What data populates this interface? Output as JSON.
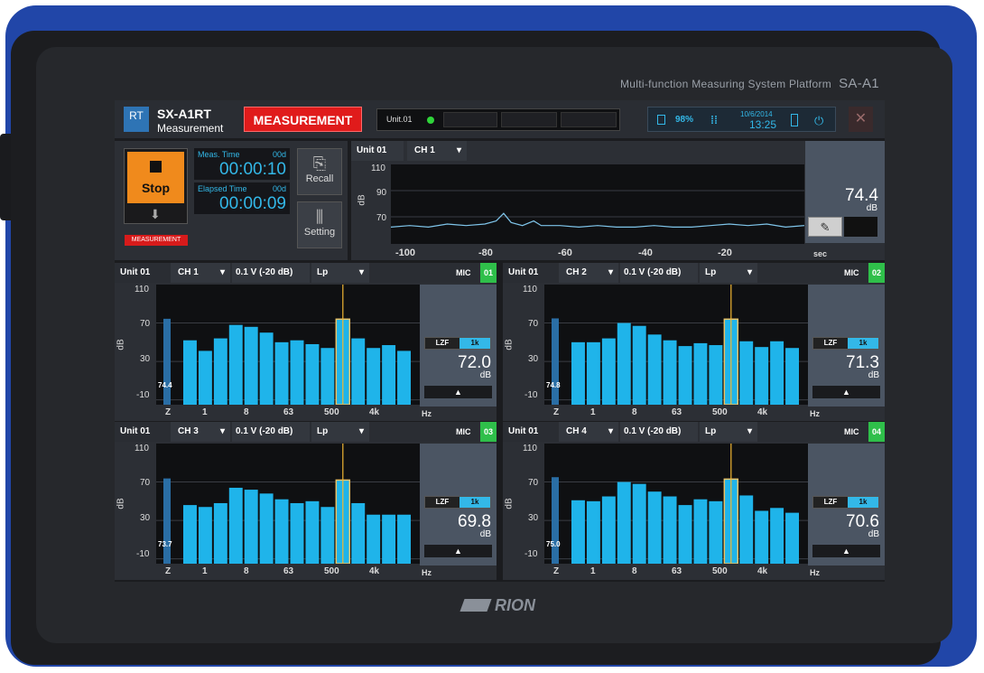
{
  "device": {
    "platform_label": "Multi-function Measuring System  Platform",
    "model": "SA-A1",
    "maker": "RION"
  },
  "header": {
    "logo_text": "RT",
    "app_name": "SX-A1RT",
    "app_mode": "Measurement",
    "state_button": "MEASUREMENT",
    "unit_label": "Unit.01",
    "battery_pct": "98%",
    "date": "10/6/2014",
    "time": "13:25",
    "close_glyph": "✕",
    "colors": {
      "accent": "#33b8e8",
      "state": "#e01b1b",
      "ok": "#2fd43a"
    }
  },
  "control": {
    "stop_label": "Stop",
    "state_badge": "MEASUREMENT",
    "meas_time_label": "Meas. Time",
    "meas_days": "00d",
    "meas_time": "00:00:10",
    "elapsed_label": "Elapsed Time",
    "elapsed_days": "00d",
    "elapsed_time": "00:00:09",
    "recall_label": "Recall",
    "setting_label": "Setting"
  },
  "timeseries": {
    "unit": "Unit 01",
    "channel": "CH 1",
    "ylabel": "dB",
    "yticks": [
      "110",
      "90",
      "70"
    ],
    "xticks": [
      "-100",
      "-80",
      "-60",
      "-40",
      "-20",
      "sec"
    ],
    "value": "74.4",
    "value_unit": "dB"
  },
  "chart_data": [
    {
      "type": "line",
      "xlabel": "sec",
      "ylabel": "dB",
      "xlim": [
        -110,
        0
      ],
      "ylim": [
        60,
        112
      ],
      "x": [
        -110,
        -105,
        -100,
        -95,
        -90,
        -85,
        -82,
        -80,
        -78,
        -75,
        -72,
        -70,
        -65,
        -60,
        -55,
        -50,
        -45,
        -40,
        -35,
        -30,
        -25,
        -20,
        -15,
        -10,
        -5,
        0
      ],
      "y": [
        71,
        72,
        71,
        73,
        72,
        73,
        75,
        80,
        74,
        72,
        75,
        72,
        72,
        71,
        72,
        71,
        71,
        72,
        71,
        71,
        72,
        73,
        72,
        73,
        71,
        72
      ]
    },
    {
      "type": "bar",
      "title": "",
      "ylabel": "dB",
      "ylim": [
        -15,
        110
      ],
      "categories": [
        "Z",
        "1",
        "",
        "",
        "8",
        "",
        "",
        "63",
        "",
        "",
        "500",
        "",
        "",
        "4k",
        "",
        ""
      ],
      "values": [
        74.4,
        52,
        41,
        54,
        68,
        66,
        60,
        50,
        52,
        48,
        44,
        74,
        54,
        44,
        47,
        41
      ],
      "highlight_index": 11
    },
    {
      "type": "bar",
      "title": "",
      "ylabel": "dB",
      "ylim": [
        -15,
        110
      ],
      "categories": [
        "Z",
        "1",
        "",
        "",
        "8",
        "",
        "",
        "63",
        "",
        "",
        "500",
        "",
        "",
        "4k",
        "",
        ""
      ],
      "values": [
        74.8,
        50,
        50,
        54,
        70,
        67,
        58,
        52,
        46,
        49,
        47,
        74,
        51,
        45,
        51,
        44
      ],
      "highlight_index": 11
    },
    {
      "type": "bar",
      "title": "",
      "ylabel": "dB",
      "ylim": [
        -15,
        110
      ],
      "categories": [
        "Z",
        "1",
        "",
        "",
        "8",
        "",
        "",
        "63",
        "",
        "",
        "500",
        "",
        "",
        "4k",
        "",
        ""
      ],
      "values": [
        73.7,
        46,
        44,
        48,
        64,
        62,
        58,
        52,
        48,
        50,
        44,
        72,
        48,
        36,
        36,
        36
      ],
      "highlight_index": 11
    },
    {
      "type": "bar",
      "title": "",
      "ylabel": "dB",
      "ylim": [
        -15,
        110
      ],
      "categories": [
        "Z",
        "1",
        "",
        "",
        "8",
        "",
        "",
        "63",
        "",
        "",
        "500",
        "",
        "",
        "4k",
        "",
        ""
      ],
      "values": [
        75.0,
        51,
        50,
        55,
        70,
        68,
        60,
        55,
        46,
        52,
        50,
        73,
        56,
        40,
        43,
        38
      ],
      "highlight_index": 11
    }
  ],
  "spectrum": {
    "panels": [
      {
        "unit": "Unit 01",
        "channel": "CH 1",
        "range": "0.1 V (-20 dB)",
        "metric": "Lp",
        "mic": "MIC",
        "mic_no": "01",
        "value": "72.0",
        "zlabel": "74.4"
      },
      {
        "unit": "Unit 01",
        "channel": "CH 2",
        "range": "0.1 V (-20 dB)",
        "metric": "Lp",
        "mic": "MIC",
        "mic_no": "02",
        "value": "71.3",
        "zlabel": "74.8"
      },
      {
        "unit": "Unit 01",
        "channel": "CH 3",
        "range": "0.1 V (-20 dB)",
        "metric": "Lp",
        "mic": "MIC",
        "mic_no": "03",
        "value": "69.8",
        "zlabel": "73.7"
      },
      {
        "unit": "Unit 01",
        "channel": "CH 4",
        "range": "0.1 V (-20 dB)",
        "metric": "Lp",
        "mic": "MIC",
        "mic_no": "04",
        "value": "70.6",
        "zlabel": "75.0"
      }
    ],
    "weight_a": "LZF",
    "weight_b": "1k",
    "value_unit": "dB",
    "ylabel": "dB",
    "yticks": [
      "110",
      "70",
      "30",
      "-10"
    ],
    "xticks": [
      "Z",
      "1",
      "8",
      "63",
      "500",
      "4k",
      "Hz"
    ]
  }
}
